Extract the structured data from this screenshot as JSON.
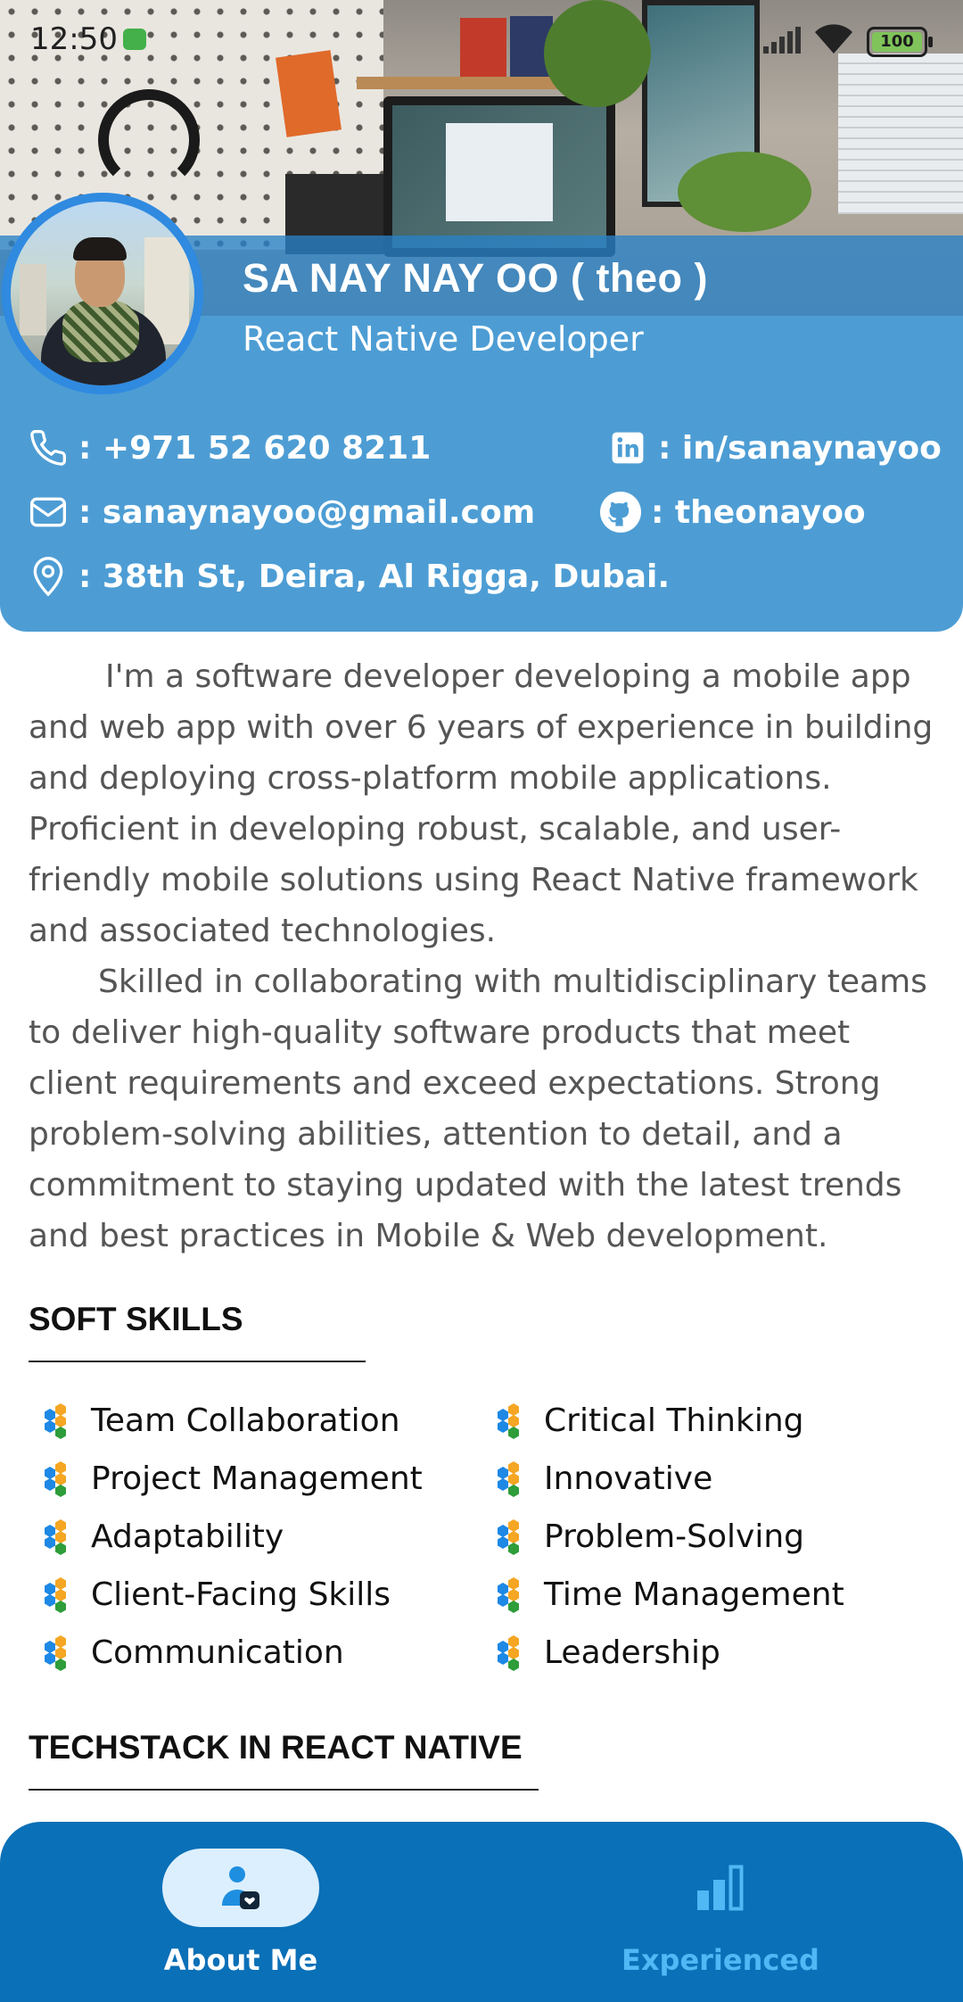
{
  "status_bar": {
    "time": "12:50",
    "battery": "100"
  },
  "profile": {
    "name": "SA NAY NAY OO ( theo )",
    "role": "React Native Developer",
    "phone": ": +971 52 620 8211",
    "email": ": sanaynayoo@gmail.com",
    "address": ": 38th St, Deira, Al Rigga, Dubai.",
    "linkedin": ": in/sanaynayoo",
    "github": ": theonayoo"
  },
  "about": {
    "paragraphs": [
      "I'm a software developer developing a mobile app and web app with over 6 years of experience in building and deploying cross-platform mobile applications. Proficient in developing robust, scalable, and user-friendly mobile solutions using React Native framework and associated technologies.",
      "Skilled in collaborating with multidisciplinary teams to deliver high-quality software products that meet client requirements and exceed expectations. Strong problem-solving abilities, attention to detail, and a commitment to staying updated with the latest trends and best practices in Mobile & Web development."
    ]
  },
  "soft_skills": {
    "title": "SOFT SKILLS",
    "items": [
      "Team Collaboration",
      "Critical Thinking",
      "Project Management",
      "Innovative",
      "Adaptability",
      "Problem-Solving",
      "Client-Facing Skills",
      "Time Management",
      "Communication",
      "Leadership"
    ]
  },
  "techstack": {
    "title": "TECHSTACK IN REACT NATIVE"
  },
  "bottom_nav": {
    "items": [
      {
        "label": "About Me",
        "icon": "user-icon",
        "active": true
      },
      {
        "label": "Experienced",
        "icon": "bar-chart-icon",
        "active": false
      }
    ]
  },
  "colors": {
    "panel": "#4d9dd4",
    "name_band": "#2882c8",
    "nav": "#0a70b7",
    "nav_active_pill": "#dcefff",
    "nav_inactive_label": "#4fb8f5",
    "hex_blue": "#1e88e5",
    "hex_orange": "#f5a623",
    "hex_green": "#2e9d3a"
  }
}
